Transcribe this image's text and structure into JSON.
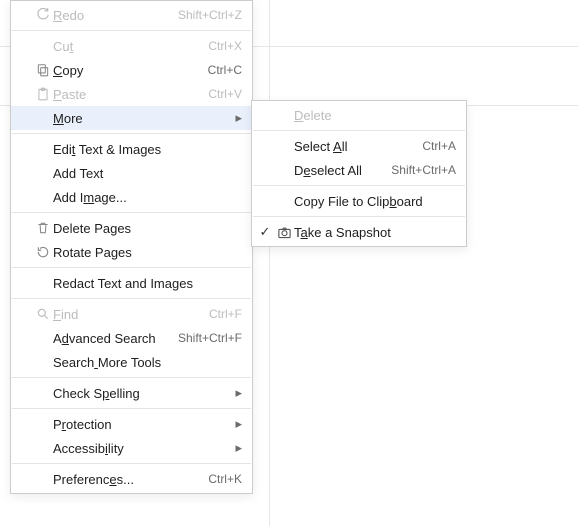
{
  "menu1": {
    "redo": {
      "label": "Redo",
      "shortcut": "Shift+Ctrl+Z",
      "ul": 0
    },
    "cut": {
      "label": "Cut",
      "shortcut": "Ctrl+X",
      "ul": 2
    },
    "copy": {
      "label": "Copy",
      "shortcut": "Ctrl+C",
      "ul": 0
    },
    "paste": {
      "label": "Paste",
      "shortcut": "Ctrl+V",
      "ul": 0
    },
    "more": {
      "label": "More",
      "ul": 0
    },
    "edittext": {
      "label": "Edit Text & Images",
      "ul": 3
    },
    "addtext": {
      "label": "Add Text"
    },
    "addimage": {
      "label": "Add Image...",
      "ul": 5
    },
    "deletepages": {
      "label": "Delete Pages",
      "ul": -1
    },
    "rotatepages": {
      "label": "Rotate Pages",
      "ul": -1
    },
    "redact": {
      "label": "Redact Text and Images"
    },
    "find": {
      "label": "Find",
      "shortcut": "Ctrl+F",
      "ul": 0
    },
    "advsearch": {
      "label": "Advanced Search",
      "shortcut": "Shift+Ctrl+F",
      "ul": 1
    },
    "searchmore": {
      "label": "Search More Tools",
      "ul": 6
    },
    "spelling": {
      "label": "Check Spelling",
      "ul": 7
    },
    "protection": {
      "label": "Protection",
      "ul": 1
    },
    "accessibility": {
      "label": "Accessibility",
      "ul": 8
    },
    "prefs": {
      "label": "Preferences...",
      "shortcut": "Ctrl+K",
      "ul": 9
    }
  },
  "menu2": {
    "delete": {
      "label": "Delete",
      "ul": 0
    },
    "selectall": {
      "label": "Select All",
      "shortcut": "Ctrl+A",
      "ul": 7
    },
    "deselect": {
      "label": "Deselect All",
      "shortcut": "Shift+Ctrl+A",
      "ul": 1
    },
    "copyfile": {
      "label": "Copy File to Clipboard",
      "ul": 17
    },
    "snapshot": {
      "label": "Take a Snapshot",
      "ul": 1,
      "checked": true
    }
  }
}
